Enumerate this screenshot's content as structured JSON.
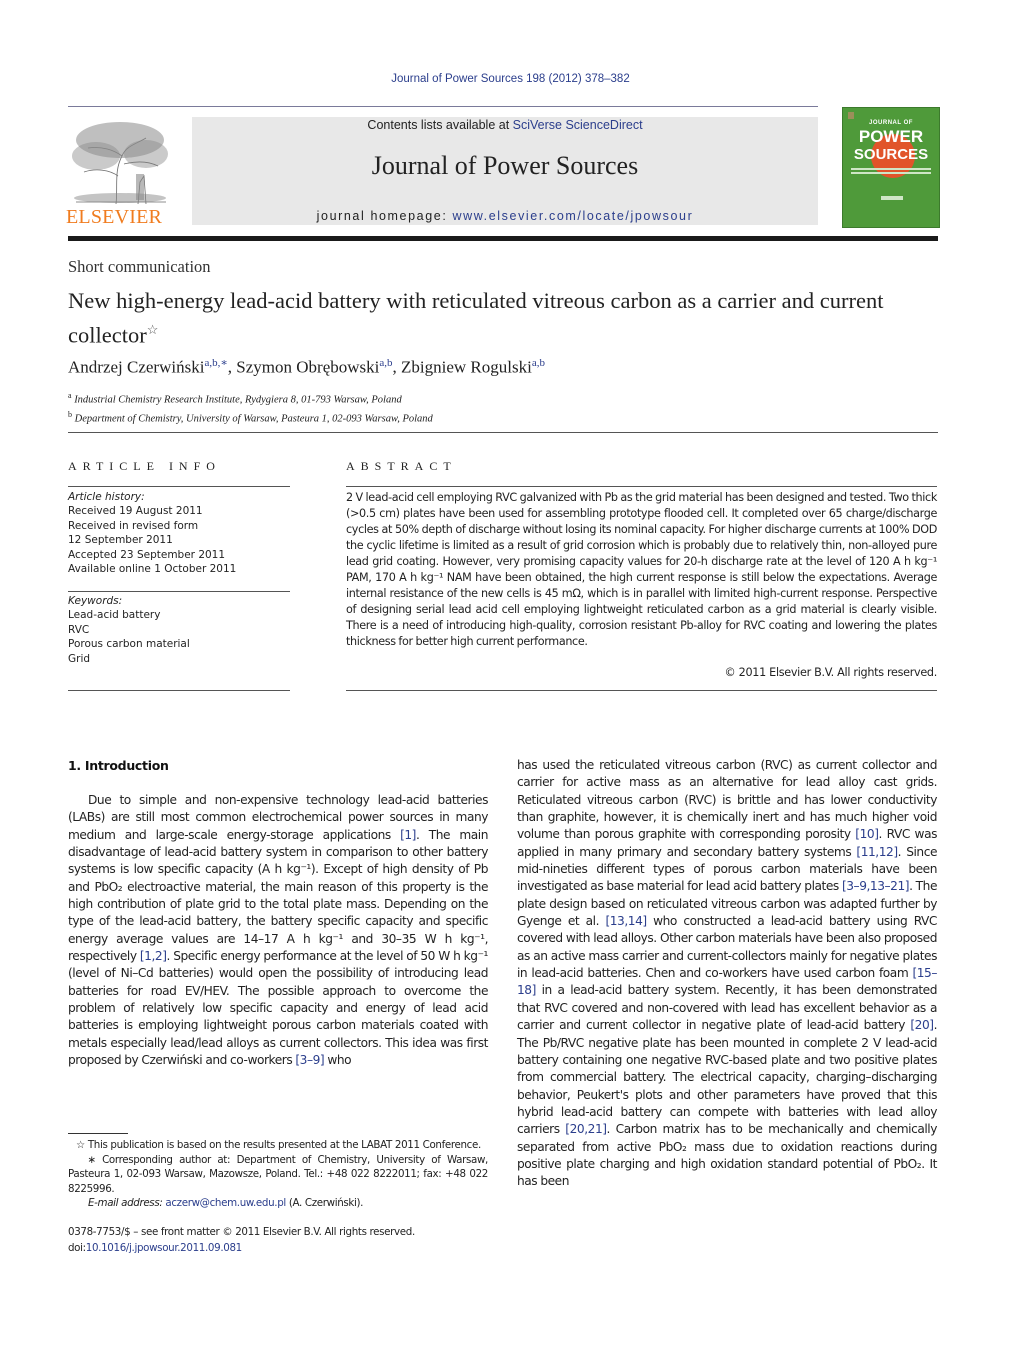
{
  "running_head": "Journal of Power Sources 198 (2012) 378–382",
  "publisher": {
    "name": "ELSEVIER",
    "logo_icon": "elsevier-tree-logo",
    "brand_color": "#f07c1f"
  },
  "masthead": {
    "contents_prefix": "Contents lists available at ",
    "contents_link": "SciVerse ScienceDirect",
    "journal_title": "Journal of Power Sources",
    "homepage_prefix": "journal homepage: ",
    "homepage_link": "www.elsevier.com/locate/jpowsour",
    "background": "#e8e8e8"
  },
  "cover": {
    "small_label": "JOURNAL OF",
    "big_line1": "POWER",
    "big_line2": "SOURCES",
    "background": "#4f9a3a",
    "accent": "#e1542a"
  },
  "article": {
    "type": "Short communication",
    "title": "New high-energy lead-acid battery with reticulated vitreous carbon as a carrier and current collector",
    "title_mark": "☆",
    "authors": [
      {
        "name": "Andrzej Czerwiński",
        "sup": "a,b,∗"
      },
      {
        "name": "Szymon Obrębowski",
        "sup": "a,b"
      },
      {
        "name": "Zbigniew Rogulski",
        "sup": "a,b"
      }
    ],
    "affiliations": [
      {
        "mark": "a",
        "text": "Industrial Chemistry Research Institute, Rydygiera 8, 01-793 Warsaw, Poland"
      },
      {
        "mark": "b",
        "text": "Department of Chemistry, University of Warsaw, Pasteura 1, 02-093 Warsaw, Poland"
      }
    ]
  },
  "article_info": {
    "heading": "ARTICLE INFO",
    "history_label": "Article history:",
    "history": [
      "Received 19 August 2011",
      "Received in revised form",
      "12 September 2011",
      "Accepted 23 September 2011",
      "Available online 1 October 2011"
    ],
    "keywords_label": "Keywords:",
    "keywords": [
      "Lead-acid battery",
      "RVC",
      "Porous carbon material",
      "Grid"
    ]
  },
  "abstract": {
    "heading": "ABSTRACT",
    "text": "2 V lead-acid cell employing RVC galvanized with Pb as the grid material has been designed and tested. Two thick (>0.5 cm) plates have been used for assembling prototype flooded cell. It completed over 65 charge/discharge cycles at 50% depth of discharge without losing its nominal capacity. For higher discharge currents at 100% DOD the cyclic lifetime is limited as a result of grid corrosion which is probably due to relatively thin, non-alloyed pure lead grid coating. However, very promising capacity values for 20-h discharge rate at the level of 120 A h kg⁻¹ PAM, 170 A h kg⁻¹ NAM have been obtained, the high current response is still below the expectations. Average internal resistance of the new cells is 45 mΩ, which is in parallel with limited high-current response. Perspective of designing serial lead acid cell employing lightweight reticulated carbon as a grid material is clearly visible. There is a need of introducing high-quality, corrosion resistant Pb-alloy for RVC coating and lowering the plates thickness for better high current performance.",
    "copyright": "© 2011 Elsevier B.V. All rights reserved."
  },
  "introduction": {
    "heading": "1.  Introduction",
    "left_segments": [
      {
        "t": "Due to simple and non-expensive technology lead-acid batteries (LABs) are still most common electrochemical power sources in many medium and large-scale energy-storage applications "
      },
      {
        "ref": "[1]"
      },
      {
        "t": ". The main disadvantage of lead-acid battery system in comparison to other battery systems is low specific capacity (A h kg⁻¹). Except of high density of Pb and PbO₂ electroactive material, the main reason of this property is the high contribution of plate grid to the total plate mass. Depending on the type of the lead-acid battery, the battery specific capacity and specific energy average values are 14–17 A h kg⁻¹ and 30–35 W h kg⁻¹, respectively "
      },
      {
        "ref": "[1,2]"
      },
      {
        "t": ". Specific energy performance at the level of 50 W h kg⁻¹ (level of Ni–Cd batteries) would open the possibility of introducing lead batteries for road EV/HEV. The possible approach to overcome the problem of relatively low specific capacity and energy of lead acid batteries is employing lightweight porous carbon materials coated with metals especially lead/lead alloys as current collectors. This idea was first proposed by Czerwiński and co-workers "
      },
      {
        "ref": "[3–9]"
      },
      {
        "t": " who"
      }
    ],
    "right_segments": [
      {
        "t": "has used the reticulated vitreous carbon (RVC) as current collector and carrier for active mass as an alternative for lead alloy cast grids. Reticulated vitreous carbon (RVC) is brittle and has lower conductivity than graphite, however, it is chemically inert and has much higher void volume than porous graphite with corresponding porosity "
      },
      {
        "ref": "[10]"
      },
      {
        "t": ". RVC was applied in many primary and secondary battery systems "
      },
      {
        "ref": "[11,12]"
      },
      {
        "t": ". Since mid-nineties different types of porous carbon materials have been investigated as base material for lead acid battery plates "
      },
      {
        "ref": "[3–9,13–21]"
      },
      {
        "t": ". The plate design based on reticulated vitreous carbon was adapted further by Gyenge et al. "
      },
      {
        "ref": "[13,14]"
      },
      {
        "t": " who constructed a lead-acid battery using RVC covered with lead alloys. Other carbon materials have been also proposed as an active mass carrier and current-collectors mainly for negative plates in lead-acid batteries. Chen and co-workers have used carbon foam "
      },
      {
        "ref": "[15–18]"
      },
      {
        "t": " in a lead-acid battery system. Recently, it has been demonstrated that RVC covered and non-covered with lead has excellent behavior as a carrier and current collector in negative plate of lead-acid battery "
      },
      {
        "ref": "[20]"
      },
      {
        "t": ". The Pb/RVC negative plate has been mounted in complete 2 V lead-acid battery containing one negative RVC-based plate and two positive plates from commercial battery. The electrical capacity, charging–discharging behavior, Peukert's plots and other parameters have proved that this hybrid lead-acid battery can compete with batteries with lead alloy carriers "
      },
      {
        "ref": "[20,21]"
      },
      {
        "t": ". Carbon matrix has to be mechanically and chemically separated from active PbO₂ mass due to oxidation reactions during positive plate charging and high oxidation standard potential of PbO₂. It has been"
      }
    ]
  },
  "footnotes": {
    "star_mark": "☆",
    "star_text": "This publication is based on the results presented at the LABAT 2011 Conference.",
    "corr_mark": "∗",
    "corr_text": "Corresponding author at: Department of Chemistry, University of Warsaw, Pasteura 1, 02-093 Warsaw, Mazowsze, Poland. Tel.: +48 022 8222011; fax: +48 022 8225996.",
    "email_label": "E-mail address:",
    "email": "aczerw@chem.uw.edu.pl",
    "email_owner": "(A. Czerwiński)."
  },
  "issn": {
    "line": "0378-7753/$ – see front matter © 2011 Elsevier B.V. All rights reserved.",
    "doi_prefix": "doi:",
    "doi": "10.1016/j.jpowsour.2011.09.081"
  },
  "link_color": "#2b3e8c"
}
